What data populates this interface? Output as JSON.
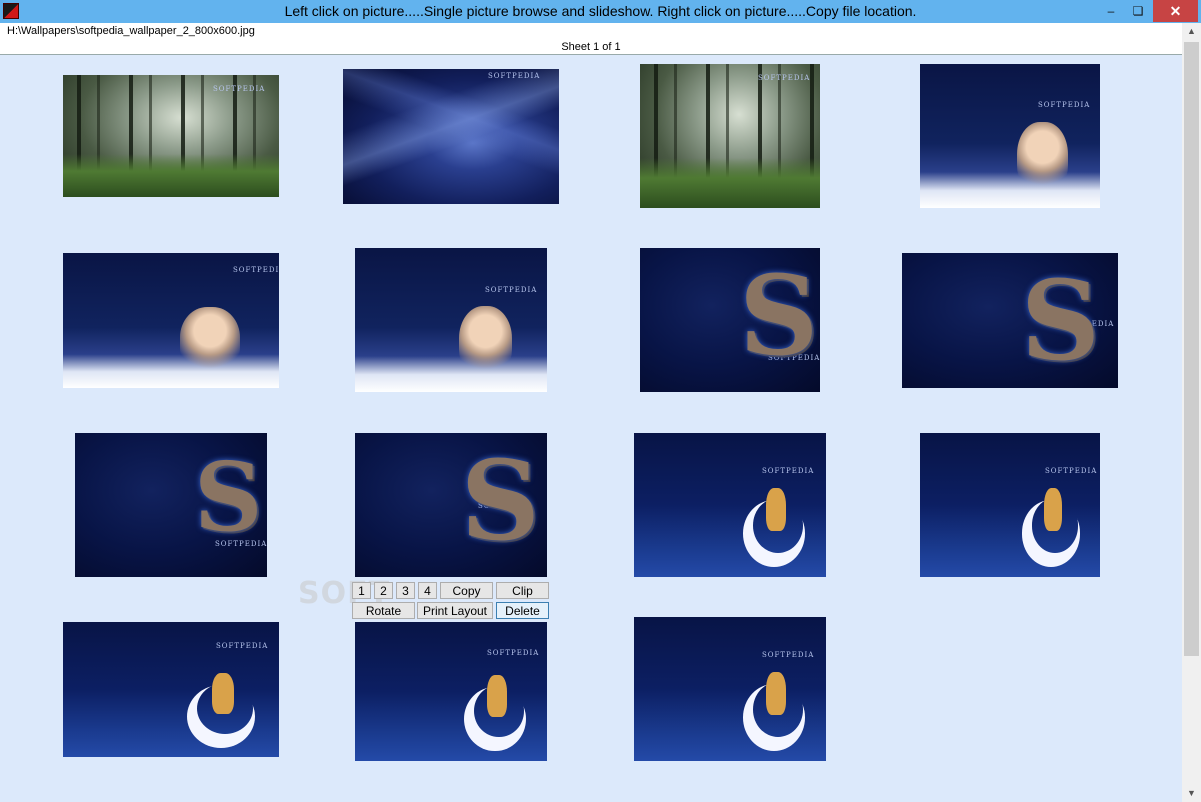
{
  "window": {
    "title": "Left click on picture.....Single picture browse and slideshow.   Right click on picture.....Copy file location.",
    "controls": {
      "minimize": "–",
      "maximize": "❏",
      "close": "✕"
    }
  },
  "pathbar": {
    "path": "H:\\Wallpapers\\softpedia_wallpaper_2_800x600.jpg",
    "sheet": "Sheet 1 of 1"
  },
  "thumbnails": [
    {
      "theme": "forest",
      "logo": "SOFTPEDIA"
    },
    {
      "theme": "swirl",
      "logo": "SOFTPEDIA"
    },
    {
      "theme": "forest",
      "logo": "SOFTPEDIA"
    },
    {
      "theme": "woman",
      "logo": "SOFTPEDIA"
    },
    {
      "theme": "woman",
      "logo": "SOFTPEDIA"
    },
    {
      "theme": "woman",
      "logo": "SOFTPEDIA"
    },
    {
      "theme": "s-logo",
      "logo": "SOFTPEDIA"
    },
    {
      "theme": "s-logo",
      "logo": "SOFTPEDIA"
    },
    {
      "theme": "s-logo",
      "logo": "SOFTPEDIA"
    },
    {
      "theme": "s-logo",
      "logo": "SOFTPEDIA"
    },
    {
      "theme": "moon",
      "logo": "SOFTPEDIA"
    },
    {
      "theme": "moon",
      "logo": "SOFTPEDIA"
    },
    {
      "theme": "moon",
      "logo": "SOFTPEDIA"
    },
    {
      "theme": "moon",
      "logo": "SOFTPEDIA"
    },
    {
      "theme": "moon",
      "logo": "SOFTPEDIA"
    }
  ],
  "controls": {
    "btn1": "1",
    "btn2": "2",
    "btn3": "3",
    "btn4": "4",
    "copy": "Copy",
    "clip": "Clip",
    "rotate": "Rotate",
    "print_layout": "Print Layout",
    "delete": "Delete"
  },
  "watermark": "SOFT"
}
